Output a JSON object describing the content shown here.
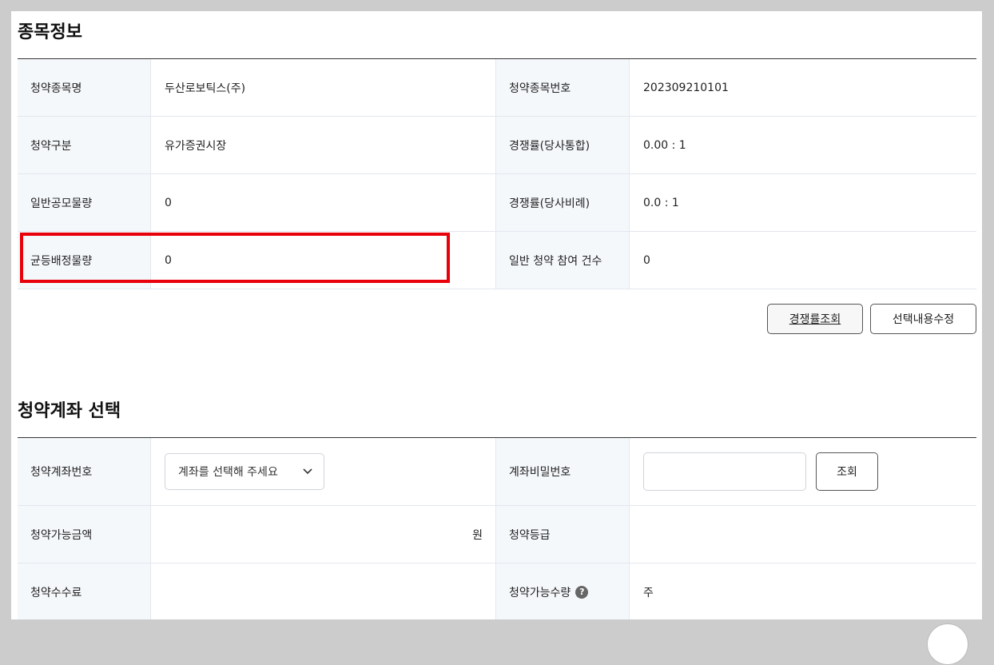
{
  "stock_info": {
    "title": "종목정보",
    "rows": [
      {
        "l1": "청약종목명",
        "v1": "두산로보틱스(주)",
        "l2": "청약종목번호",
        "v2": "202309210101"
      },
      {
        "l1": "청약구분",
        "v1": "유가증권시장",
        "l2": "경쟁률(당사통합)",
        "v2": "0.00 : 1"
      },
      {
        "l1": "일반공모물량",
        "v1": "0",
        "l2": "경쟁률(당사비례)",
        "v2": "0.0 : 1"
      },
      {
        "l1": "균등배정물량",
        "v1": "0",
        "l2": "일반 청약 참여 건수",
        "v2": "0"
      }
    ],
    "rate_button": "경쟁률조회",
    "edit_button": "선택내용수정"
  },
  "account": {
    "title": "청약계좌 선택",
    "account_no_label": "청약계좌번호",
    "account_select_placeholder": "계좌를 선택해 주세요",
    "password_label": "계좌비밀번호",
    "lookup_button": "조회",
    "available_amount_label": "청약가능금액",
    "available_amount_unit": "원",
    "grade_label": "청약등급",
    "fee_label": "청약수수료",
    "available_qty_label": "청약가능수량",
    "available_qty_unit": "주",
    "help_glyph": "?"
  },
  "colors": {
    "highlight": "#e8000b",
    "label_bg": "#f5f8fb",
    "page_bg": "#cccccc"
  }
}
